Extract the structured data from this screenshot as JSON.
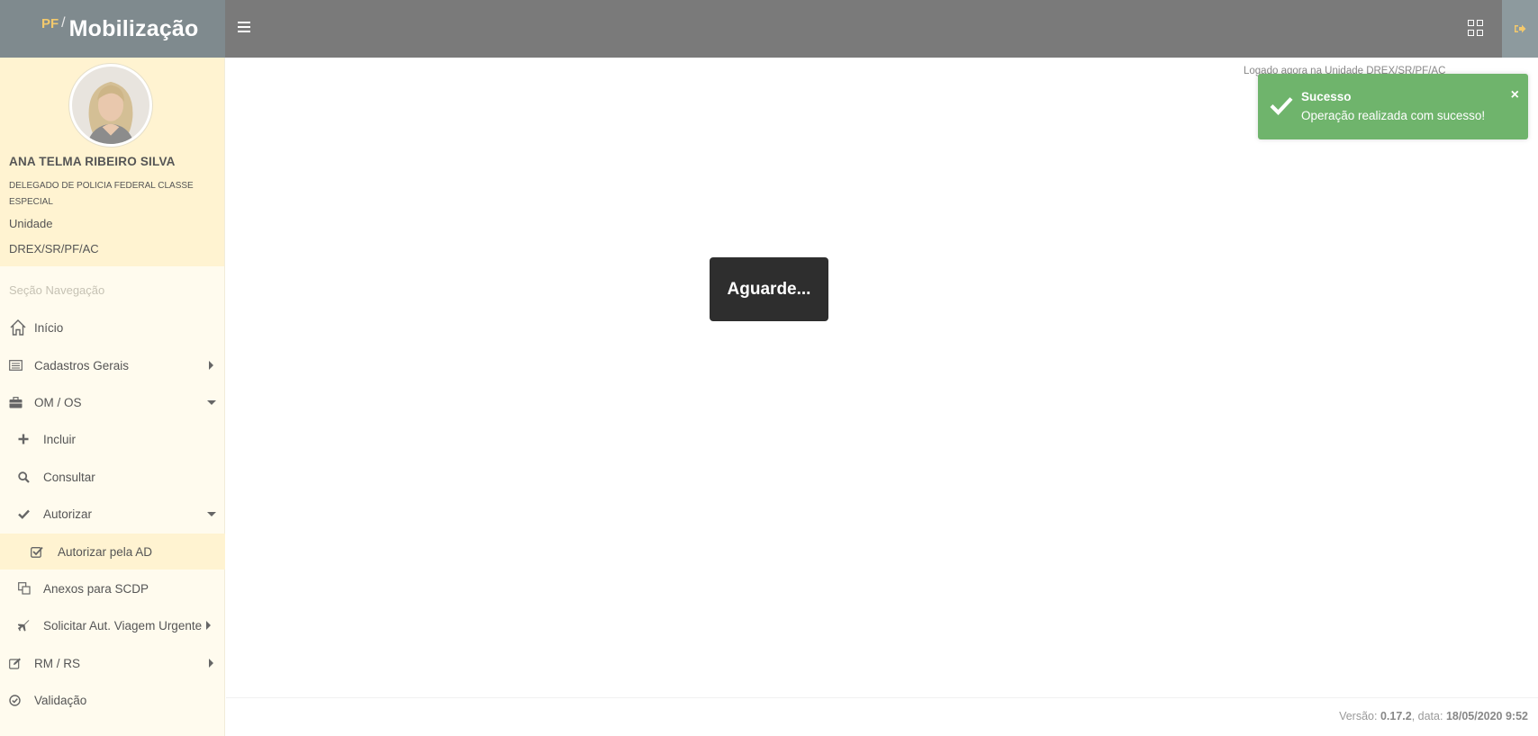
{
  "brand": {
    "prefix": "PF",
    "slash": "/",
    "title": "Mobilização"
  },
  "header": {
    "menu_icon": "hamburger-icon",
    "apps_icon": "grid-icon",
    "logout_icon": "sign-out-icon"
  },
  "profile": {
    "name": "ANA TELMA RIBEIRO SILVA",
    "role": "DELEGADO DE POLICIA FEDERAL CLASSE ESPECIAL",
    "unit_label": "Unidade",
    "unit": "DREX/SR/PF/AC"
  },
  "sidebar": {
    "section_title": "Seção Navegação",
    "items": [
      {
        "label": "Início",
        "icon": "home-icon"
      },
      {
        "label": "Cadastros Gerais",
        "icon": "list-icon"
      },
      {
        "label": "OM / OS",
        "icon": "briefcase-icon"
      },
      {
        "label": "Incluir",
        "icon": "plus-icon"
      },
      {
        "label": "Consultar",
        "icon": "search-icon"
      },
      {
        "label": "Autorizar",
        "icon": "check-icon"
      },
      {
        "label": "Autorizar pela AD",
        "icon": "checkbox-icon"
      },
      {
        "label": "Anexos para SCDP",
        "icon": "copy-icon"
      },
      {
        "label": "Solicitar Aut. Viagem Urgente",
        "icon": "plane-icon"
      },
      {
        "label": "RM / RS",
        "icon": "edit-icon"
      },
      {
        "label": "Validação",
        "icon": "check-circle-icon"
      }
    ]
  },
  "main": {
    "logged_text": "Logado agora na Unidade DREX/SR/PF/AC",
    "loading_text": "Aguarde..."
  },
  "toast": {
    "title": "Sucesso",
    "message": "Operação realizada com sucesso!",
    "close": "×"
  },
  "footer": {
    "version_label": "Versão:",
    "version": "0.17.2",
    "date_label": ", data:",
    "date": "18/05/2020 9:52"
  },
  "colors": {
    "toast_bg": "#6fb46c",
    "sidebar_bg": "#fffbee",
    "profile_bg": "#fff3d1",
    "topbar": "#7a7a7a",
    "brand_accent": "#f3c96c"
  }
}
